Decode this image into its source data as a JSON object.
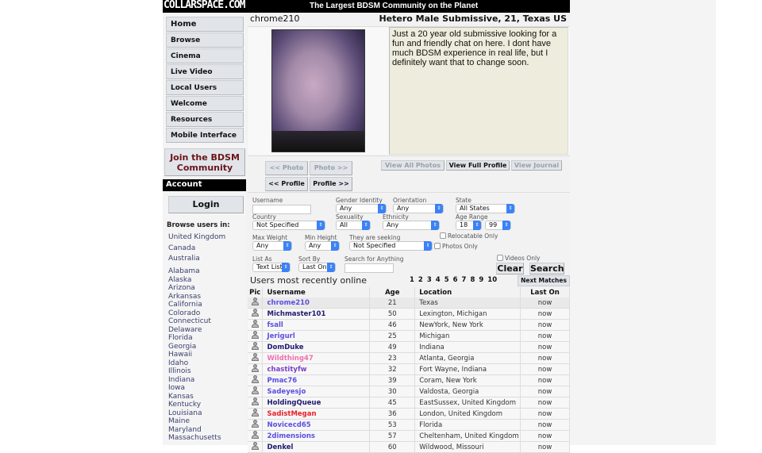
{
  "header": {
    "logo": "COLLARSPACE.COM",
    "tagline": "The Largest BDSM Community on the Planet"
  },
  "sidebar": {
    "nav": [
      "Home",
      "Browse",
      "Cinema",
      "Live Video",
      "Local Users",
      "Welcome",
      "Resources",
      "Mobile Interface"
    ],
    "join_label": "Join the BDSM Community",
    "account_label": "Account",
    "login_label": "Login",
    "browse_heading": "Browse users in:",
    "browse_countries": [
      "United Kingdom",
      "Canada",
      "Australia"
    ],
    "browse_states": [
      "Alabama",
      "Alaska",
      "Arizona",
      "Arkansas",
      "California",
      "Colorado",
      "Connecticut",
      "Delaware",
      "Florida",
      "Georgia",
      "Hawaii",
      "Idaho",
      "Illinois",
      "Indiana",
      "Iowa",
      "Kansas",
      "Kentucky",
      "Louisiana",
      "Maine",
      "Maryland",
      "Massachusetts"
    ]
  },
  "profile": {
    "username": "chrome210",
    "summary": "Hetero Male Submissive, 21, Texas US",
    "about": "Just a 20 year old submissive looking for a fun and friendly chat on here. I dont have much BDSM experience in real life, but I definitely want that to change soon.",
    "buttons": {
      "prev_photo": "<< Photo",
      "next_photo": "Photo >>",
      "prev_profile": "<< Profile",
      "next_profile": "Profile >>",
      "view_all_photos": "View All Photos",
      "view_full_profile": "View Full Profile",
      "view_journal": "View Journal"
    }
  },
  "search": {
    "username_label": "Username",
    "username_value": "",
    "gender_label": "Gender Identity",
    "gender_value": "Any",
    "orientation_label": "Orientation",
    "orientation_value": "Any",
    "state_label": "State",
    "state_value": "All States",
    "country_label": "Country",
    "country_value": "Not Specified",
    "sexuality_label": "Sexuality",
    "sexuality_value": "All",
    "ethnicity_label": "Ethnicity",
    "ethnicity_value": "Any",
    "age_range_label": "Age Range",
    "age_min": "18",
    "age_max": "99",
    "max_weight_label": "Max Weight",
    "max_weight_value": "Any",
    "min_height_label": "Min Height",
    "min_height_value": "Any",
    "seeking_label": "They are seeking",
    "seeking_value": "Not Specified",
    "relocatable_label": "Relocatable Only",
    "photos_only_label": "Photos Only",
    "videos_only_label": "Videos Only",
    "list_as_label": "List As",
    "list_as_value": "Text List",
    "sort_by_label": "Sort By",
    "sort_by_value": "Last On",
    "anything_label": "Search for Anything",
    "anything_value": "",
    "clear_label": "Clear",
    "search_label": "Search"
  },
  "results": {
    "title": "Users most recently online",
    "pages": [
      "1",
      "2",
      "3",
      "4",
      "5",
      "6",
      "7",
      "8",
      "9",
      "10"
    ],
    "next_label": "Next Matches",
    "columns": [
      "Pic",
      "Username",
      "Age",
      "Location",
      "Last On"
    ],
    "rows": [
      {
        "username": "chrome210",
        "age": "21",
        "location": "Texas",
        "last_on": "now",
        "color": "#5a4fe0"
      },
      {
        "username": "Michmaster101",
        "age": "50",
        "location": "Lexington, Michigan",
        "last_on": "now",
        "color": "#1e1a6e"
      },
      {
        "username": "fsall",
        "age": "46",
        "location": "NewYork, New York",
        "last_on": "now",
        "color": "#5a4fe0"
      },
      {
        "username": "Jerigurl",
        "age": "25",
        "location": "Michigan",
        "last_on": "now",
        "color": "#5a4fe0"
      },
      {
        "username": "DomDuke",
        "age": "49",
        "location": "Indiana",
        "last_on": "now",
        "color": "#1e1a6e"
      },
      {
        "username": "Wildthing47",
        "age": "23",
        "location": "Atlanta, Georgia",
        "last_on": "now",
        "color": "#f06fb0"
      },
      {
        "username": "chastityfw",
        "age": "32",
        "location": "Fort Wayne, Indiana",
        "last_on": "now",
        "color": "#7a3fc8"
      },
      {
        "username": "Pmac76",
        "age": "39",
        "location": "Coram, New York",
        "last_on": "now",
        "color": "#5a4fe0"
      },
      {
        "username": "Sadeyesjo",
        "age": "30",
        "location": "Valdosta, Georgia",
        "last_on": "now",
        "color": "#5a4fe0"
      },
      {
        "username": "HoldingQueue",
        "age": "45",
        "location": "EastSussex, United Kingdom",
        "last_on": "now",
        "color": "#1e1a6e"
      },
      {
        "username": "SadistMegan",
        "age": "36",
        "location": "London, United Kingdom",
        "last_on": "now",
        "color": "#e8202a"
      },
      {
        "username": "Novicecd65",
        "age": "53",
        "location": "Florida",
        "last_on": "now",
        "color": "#5a4fe0"
      },
      {
        "username": "2dimensions",
        "age": "57",
        "location": "Cheltenham, United Kingdom",
        "last_on": "now",
        "color": "#5a4fe0"
      },
      {
        "username": "Denkel",
        "age": "60",
        "location": "Wildwood, Missouri",
        "last_on": "now",
        "color": "#1e1a6e"
      }
    ]
  }
}
